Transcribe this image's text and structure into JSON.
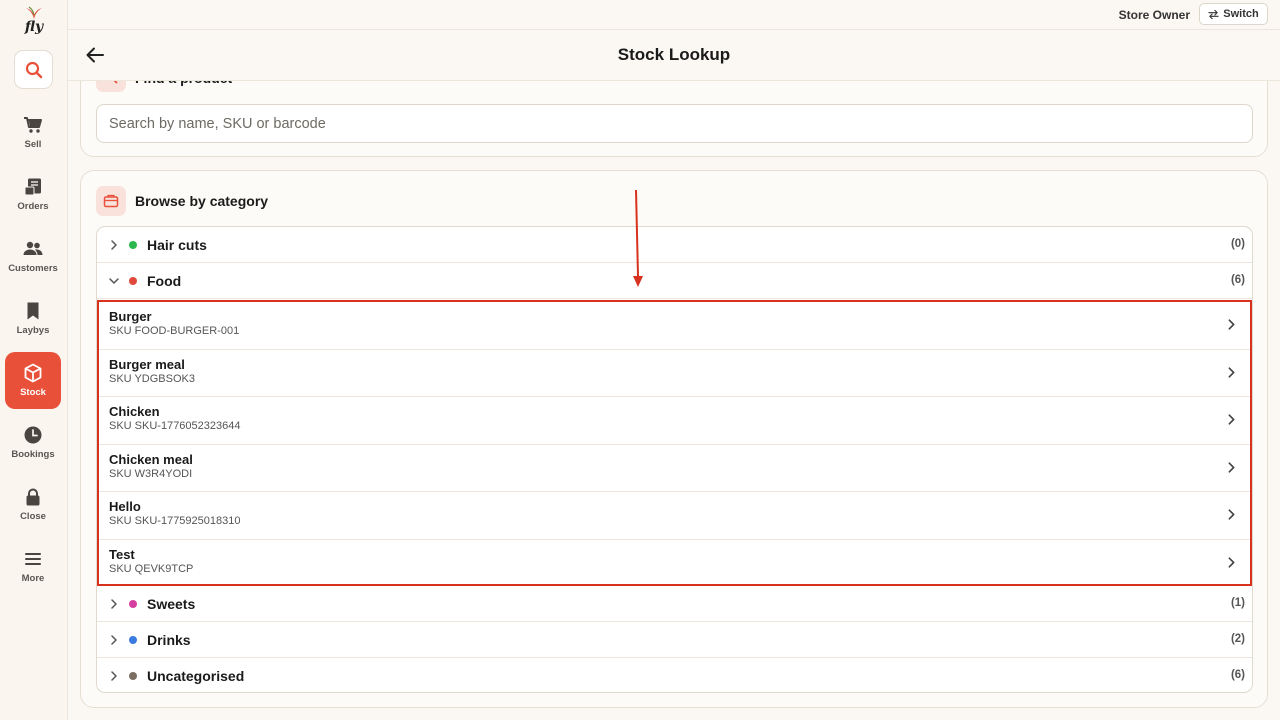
{
  "app": {
    "logo_text": "fly"
  },
  "sidebar": {
    "search_icon": "search-icon",
    "items": [
      {
        "label": "Sell",
        "icon": "cart-icon",
        "active": false
      },
      {
        "label": "Orders",
        "icon": "receipt-icon",
        "active": false
      },
      {
        "label": "Customers",
        "icon": "users-icon",
        "active": false
      },
      {
        "label": "Laybys",
        "icon": "bookmark-icon",
        "active": false
      },
      {
        "label": "Stock",
        "icon": "box-icon",
        "active": true
      },
      {
        "label": "Bookings",
        "icon": "clock-icon",
        "active": false
      },
      {
        "label": "Close",
        "icon": "lock-icon",
        "active": false
      },
      {
        "label": "More",
        "icon": "menu-icon",
        "active": false
      }
    ]
  },
  "topbar": {
    "user": "Store Owner",
    "switch_label": "Switch"
  },
  "header": {
    "title": "Stock Lookup"
  },
  "find": {
    "title": "Find a product",
    "search_placeholder": "Search by name, SKU or barcode"
  },
  "browse": {
    "title": "Browse by category",
    "categories": [
      {
        "name": "Hair cuts",
        "count": "(0)",
        "color": "#2db84d",
        "expanded": false
      },
      {
        "name": "Food",
        "count": "(6)",
        "color": "#e04a3c",
        "expanded": true
      },
      {
        "name": "Sweets",
        "count": "(1)",
        "color": "#d63fa0",
        "expanded": false
      },
      {
        "name": "Drinks",
        "count": "(2)",
        "color": "#3b7ae0",
        "expanded": false
      },
      {
        "name": "Uncategorised",
        "count": "(6)",
        "color": "#7a6e62",
        "expanded": false
      }
    ],
    "products": [
      {
        "name": "Burger",
        "sku": "SKU FOOD-BURGER-001"
      },
      {
        "name": "Burger meal",
        "sku": "SKU YDGBSOK3"
      },
      {
        "name": "Chicken",
        "sku": "SKU SKU-1776052323644"
      },
      {
        "name": "Chicken meal",
        "sku": "SKU W3R4YODI"
      },
      {
        "name": "Hello",
        "sku": "SKU SKU-1775925018310"
      },
      {
        "name": "Test",
        "sku": "SKU QEVK9TCP"
      }
    ]
  },
  "colors": {
    "accent": "#e8503a",
    "highlight": "#d7321d"
  }
}
